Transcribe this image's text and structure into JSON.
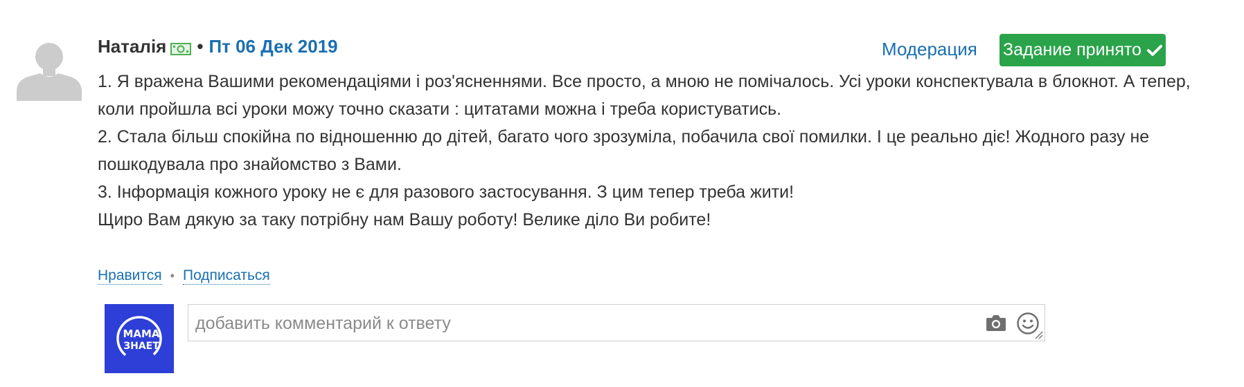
{
  "post": {
    "author": "Наталія",
    "separator": "•",
    "date": "Пт 06 Дек 2019",
    "moderation_label": "Модерация",
    "accepted_label": "Задание принято",
    "paragraphs": [
      "1. Я вражена Вашими рекомендаціями і роз'ясненнями. Все просто, а мною не помічалось. Усі уроки конспектувала в блокнот. А тепер, коли пройшла всі уроки можу точно сказати : цитатами можна і треба користуватись.",
      "2. Стала більш спокійна по відношенню до дітей, багато чого зрозуміла, побачила свої помилки. І це реально діє! Жодного разу не пошкодувала про знайомство з Вами.",
      "3. Інформація кожного уроку не є для разового застосування. З цим тепер треба жити!",
      "Щиро Вам дякую за таку потрібну нам Вашу роботу! Велике діло Ви робите!"
    ]
  },
  "actions": {
    "like_label": "Нравится",
    "dot": "•",
    "subscribe_label": "Подписаться"
  },
  "brand": {
    "line1": "МАМА",
    "line2": "ЗНАЕТ"
  },
  "comment": {
    "placeholder": "добавить комментарий к ответу",
    "value": ""
  },
  "icons": {
    "avatar": "default-user-avatar-icon",
    "money": "money-bill-icon",
    "check": "checkmark-icon",
    "camera": "camera-icon",
    "smile": "smile-icon",
    "resize": "resize-handle-icon"
  },
  "colors": {
    "link": "#1a6fb0",
    "accept_button": "#2aa34a",
    "brand_background": "#2d3fd6",
    "text": "#333333"
  }
}
